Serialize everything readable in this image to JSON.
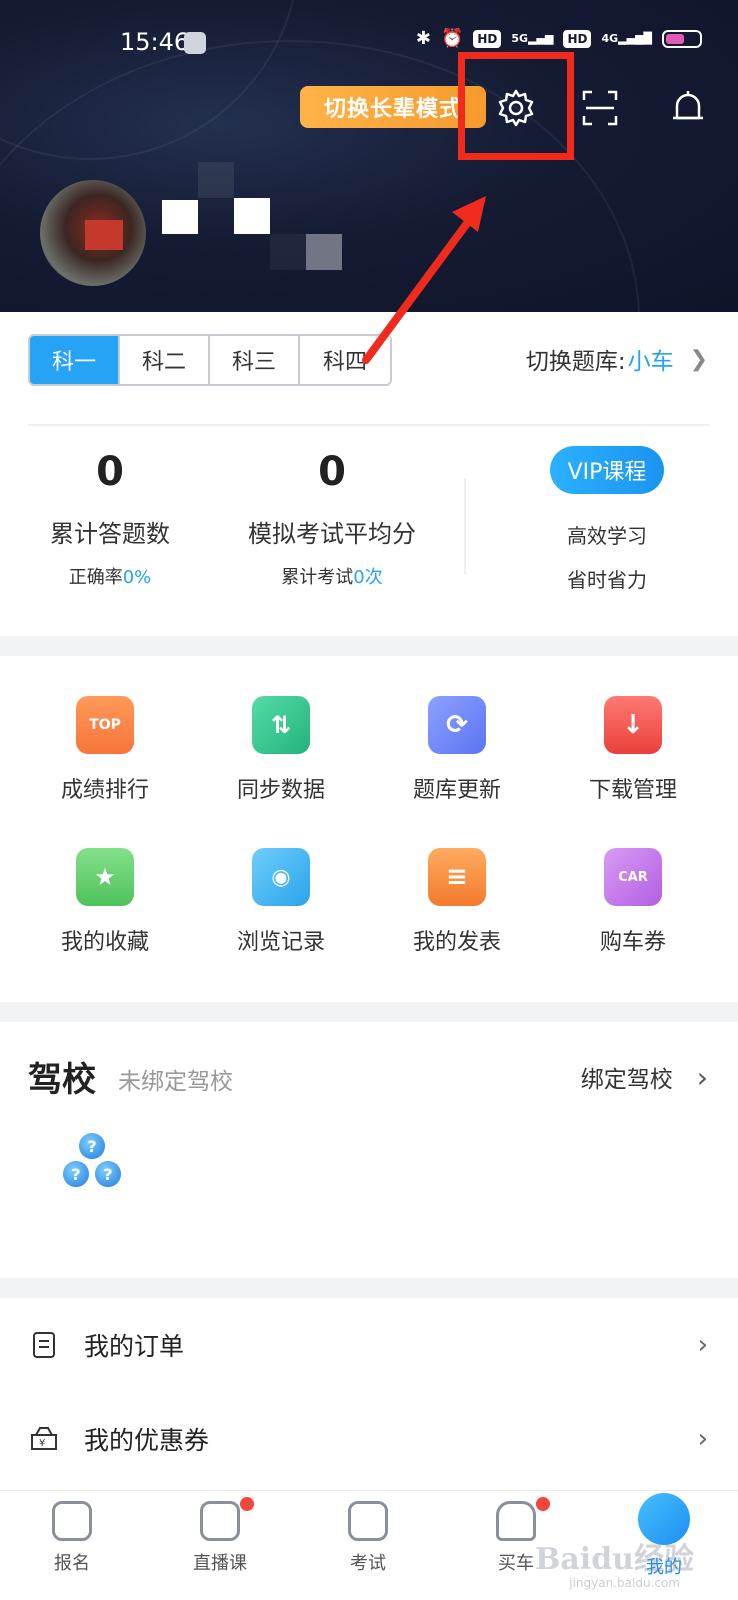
{
  "status_bar": {
    "time": "15:46",
    "icons": [
      "bluetooth-icon",
      "alarm-icon",
      "hd-icon",
      "5g-signal-icon",
      "hd-icon",
      "4g-signal-icon",
      "battery-icon"
    ],
    "network_5g": "5G",
    "network_4g": "4G",
    "hd": "HD"
  },
  "header": {
    "elder_mode_label": "切换长辈模式",
    "accent": "#f02a1c"
  },
  "subjects": {
    "tabs": [
      "科一",
      "科二",
      "科三",
      "科四"
    ],
    "active_index": 0,
    "switch_bank_label": "切换题库:",
    "switch_bank_value": "小车"
  },
  "stats": {
    "answered_count": "0",
    "answered_label": "累计答题数",
    "accuracy_label": "正确率",
    "accuracy_value": "0%",
    "avg_score": "0",
    "avg_score_label": "模拟考试平均分",
    "exam_count_label": "累计考试",
    "exam_count_value": "0次",
    "vip_button": "VIP课程",
    "vip_line1": "高效学习",
    "vip_line2": "省时省力"
  },
  "grid": {
    "items": [
      {
        "label": "成绩排行",
        "icon": "trophy-icon",
        "icon_text": "TOP",
        "color": "#f7743a"
      },
      {
        "label": "同步数据",
        "icon": "sync-icon",
        "icon_text": "⇅",
        "color": "#2fc48a"
      },
      {
        "label": "题库更新",
        "icon": "refresh-icon",
        "icon_text": "⟳",
        "color": "#6f86f7"
      },
      {
        "label": "下载管理",
        "icon": "download-icon",
        "icon_text": "↓",
        "color": "#f2504a"
      },
      {
        "label": "我的收藏",
        "icon": "star-folder-icon",
        "icon_text": "★",
        "color": "#5fd06a"
      },
      {
        "label": "浏览记录",
        "icon": "history-icon",
        "icon_text": "◉",
        "color": "#3fb0f0"
      },
      {
        "label": "我的发表",
        "icon": "post-icon",
        "icon_text": "≡",
        "color": "#f7893a"
      },
      {
        "label": "购车券",
        "icon": "car-coupon-icon",
        "icon_text": "CAR",
        "color": "#c06ae8"
      }
    ]
  },
  "school": {
    "title": "驾校",
    "subtitle": "未绑定驾校",
    "bind_label": "绑定驾校",
    "ball_text": "?"
  },
  "list": {
    "items": [
      {
        "label": "我的订单",
        "icon": "order-icon"
      },
      {
        "label": "我的优惠券",
        "icon": "coupon-icon"
      }
    ]
  },
  "bottom_nav": {
    "items": [
      "报名",
      "直播课",
      "考试",
      "买车",
      "我的"
    ],
    "active_index": 4
  },
  "watermark": {
    "text": "Baidu经验",
    "sub": "jingyan.baidu.com"
  }
}
